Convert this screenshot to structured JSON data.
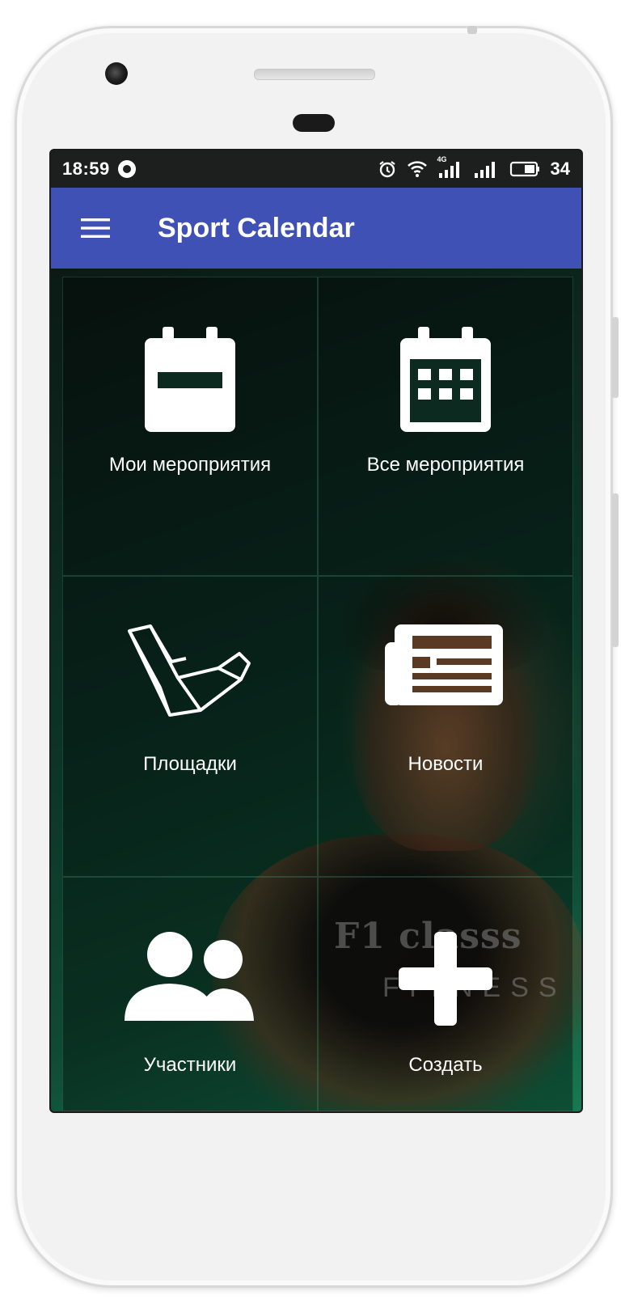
{
  "status_bar": {
    "time": "18:59",
    "network_label": "4G",
    "battery": "34",
    "icons": [
      "whatsapp-icon",
      "alarm-icon",
      "wifi-icon",
      "signal-4g-icon",
      "signal-icon",
      "battery-icon"
    ]
  },
  "app_bar": {
    "title": "Sport Calendar",
    "menu_icon": "hamburger-menu-icon",
    "color": "#3f51b5"
  },
  "background_art": {
    "shirt_logo": "F1 classs",
    "shirt_sub": "FITNESS"
  },
  "tiles": [
    {
      "label": "Мои мероприятия",
      "icon": "calendar-single-icon"
    },
    {
      "label": "Все мероприятия",
      "icon": "calendar-grid-icon"
    },
    {
      "label": "Площадки",
      "icon": "venues-icon"
    },
    {
      "label": "Новости",
      "icon": "newspaper-icon"
    },
    {
      "label": "Участники",
      "icon": "users-icon"
    },
    {
      "label": "Создать",
      "icon": "plus-icon"
    }
  ]
}
